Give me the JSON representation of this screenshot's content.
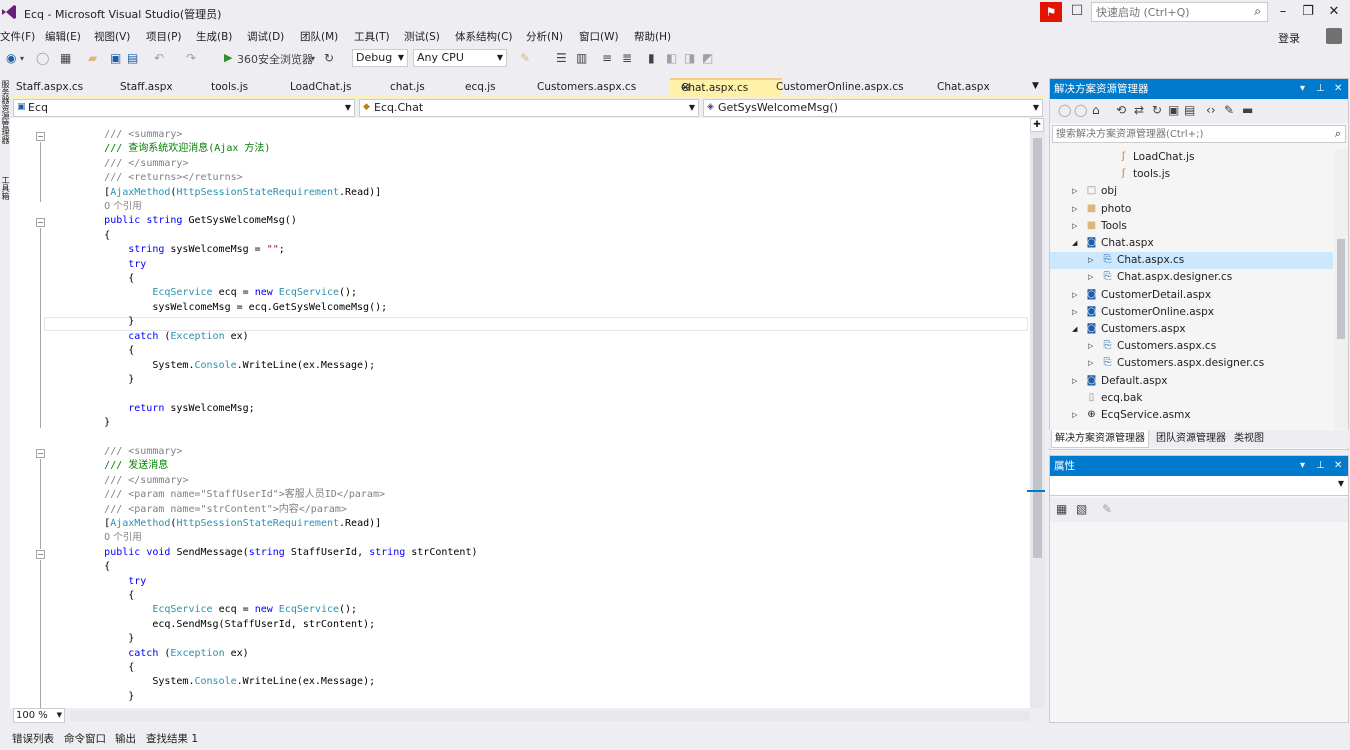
{
  "window": {
    "title": "Ecq - Microsoft Visual Studio(管理员)",
    "quick_launch_placeholder": "快速启动 (Ctrl+Q)",
    "sign_in": "登录"
  },
  "menu": [
    "文件(F)",
    "编辑(E)",
    "视图(V)",
    "项目(P)",
    "生成(B)",
    "调试(D)",
    "团队(M)",
    "工具(T)",
    "测试(S)",
    "体系结构(C)",
    "分析(N)",
    "窗口(W)",
    "帮助(H)"
  ],
  "toolbar": {
    "browser": "360安全浏览器",
    "config": "Debug",
    "platform": "Any CPU"
  },
  "left_strip": [
    "服务器资源管理器",
    "工具箱"
  ],
  "doc_tabs": [
    "Staff.aspx.cs",
    "Staff.aspx",
    "tools.js",
    "LoadChat.js",
    "chat.js",
    "ecq.js",
    "Customers.aspx.cs",
    "Chat.aspx.cs",
    "CustomerOnline.aspx.cs",
    "Chat.aspx"
  ],
  "nav": {
    "project": "Ecq",
    "class": "Ecq.Chat",
    "member": "GetSysWelcomeMsg()"
  },
  "editor": {
    "zoom": "100 %"
  },
  "solution_explorer": {
    "title": "解决方案资源管理器",
    "search_placeholder": "搜索解决方案资源管理器(Ctrl+;)",
    "items": [
      {
        "label": "LoadChat.js",
        "level": 3,
        "icon": "js-icon",
        "expander": ""
      },
      {
        "label": "tools.js",
        "level": 3,
        "icon": "js-icon",
        "expander": ""
      },
      {
        "label": "obj",
        "level": 1,
        "icon": "folder-outline-icon",
        "expander": "▷"
      },
      {
        "label": "photo",
        "level": 1,
        "icon": "folder-icon",
        "expander": "▷"
      },
      {
        "label": "Tools",
        "level": 1,
        "icon": "folder-icon",
        "expander": "▷"
      },
      {
        "label": "Chat.aspx",
        "level": 1,
        "icon": "aspx-icon",
        "expander": "◢"
      },
      {
        "label": "Chat.aspx.cs",
        "level": 2,
        "icon": "cs-file-icon",
        "expander": "▷",
        "selected": true
      },
      {
        "label": "Chat.aspx.designer.cs",
        "level": 2,
        "icon": "cs-file-icon",
        "expander": "▷"
      },
      {
        "label": "CustomerDetail.aspx",
        "level": 1,
        "icon": "aspx-icon",
        "expander": "▷"
      },
      {
        "label": "CustomerOnline.aspx",
        "level": 1,
        "icon": "aspx-icon",
        "expander": "▷"
      },
      {
        "label": "Customers.aspx",
        "level": 1,
        "icon": "aspx-icon",
        "expander": "◢"
      },
      {
        "label": "Customers.aspx.cs",
        "level": 2,
        "icon": "cs-file-icon",
        "expander": "▷"
      },
      {
        "label": "Customers.aspx.designer.cs",
        "level": 2,
        "icon": "cs-file-icon",
        "expander": "▷"
      },
      {
        "label": "Default.aspx",
        "level": 1,
        "icon": "aspx-icon",
        "expander": "▷"
      },
      {
        "label": "ecq.bak",
        "level": 1,
        "icon": "file-icon",
        "expander": ""
      },
      {
        "label": "EcqService.asmx",
        "level": 1,
        "icon": "asmx-icon",
        "expander": "▷"
      }
    ],
    "tabs": [
      "解决方案资源管理器",
      "团队资源管理器",
      "类视图"
    ]
  },
  "properties": {
    "title": "属性"
  },
  "bottom_tabs": [
    "错误列表",
    "命令窗口",
    "输出",
    "查找结果 1"
  ],
  "code": {
    "summary_open": "/// <summary>",
    "summary_close": "/// </summary>",
    "doc1": "/// 查询系统欢迎消息(Ajax 方法)",
    "returns": "/// <returns></returns>",
    "attr": "[AjaxMethod(HttpSessionStateRequirement.Read)]",
    "refs": "0 个引用",
    "sig1": "public string GetSysWelcomeMsg()",
    "brace_open": "{",
    "brace_close": "}",
    "decl": "string sysWelcomeMsg = \"\";",
    "try": "try",
    "new_svc": "EcqService ecq = new EcqService();",
    "assign": "sysWelcomeMsg = ecq.GetSysWelcomeMsg();",
    "catch": "catch (Exception ex)",
    "writeline": "System.Console.WriteLine(ex.Message);",
    "return": "return sysWelcomeMsg;",
    "doc2": "/// 发送消息",
    "param1": "/// <param name=\"StaffUserId\">客服人员ID</param>",
    "param2": "/// <param name=\"strContent\">内容</param>",
    "sig2": "public void SendMessage(string StaffUserId, string strContent)",
    "sendmsg": "ecq.SendMsg(StaffUserId, strContent);"
  },
  "colors": {
    "accent": "#007acc",
    "active_tab": "#fff1a8",
    "keyword": "#0000ff",
    "type": "#2b91af",
    "comment": "#808080",
    "doc_text": "#008000"
  }
}
